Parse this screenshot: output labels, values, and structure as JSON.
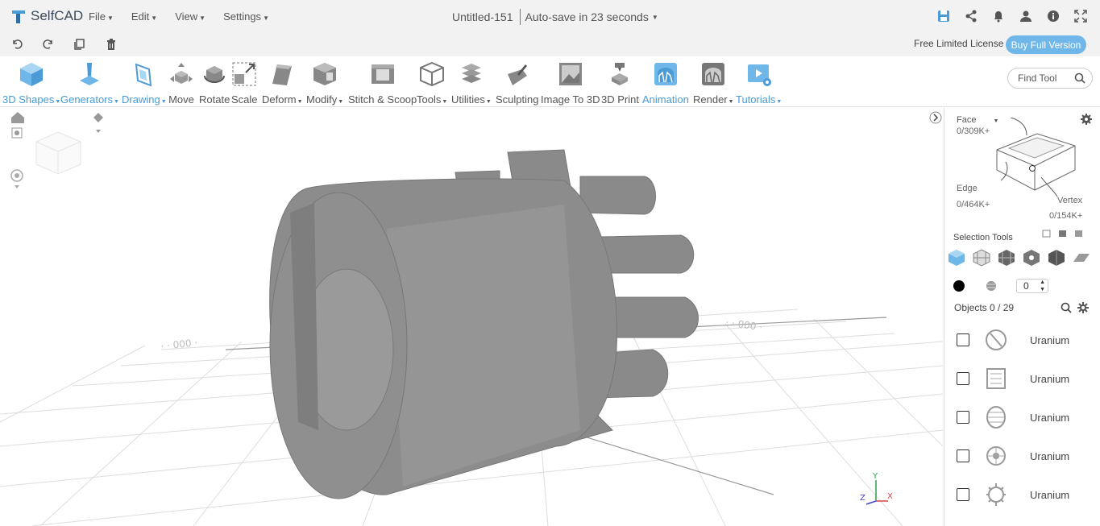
{
  "app": {
    "name": "SelfCAD",
    "brand_color": "#4a9bd6"
  },
  "menu": [
    {
      "label": "File"
    },
    {
      "label": "Edit"
    },
    {
      "label": "View"
    },
    {
      "label": "Settings"
    }
  ],
  "document": {
    "title": "Untitled-151",
    "autosave": "Auto-save in 23 seconds"
  },
  "top_icons": [
    "save-icon",
    "share-icon",
    "bell-icon",
    "user-icon",
    "info-icon",
    "fullscreen-icon"
  ],
  "secondary_icons": [
    "undo-icon",
    "redo-icon",
    "copy-icon",
    "delete-icon"
  ],
  "license": {
    "text": "Free Limited License",
    "button": "Buy Full Version"
  },
  "toolbar": {
    "tools": [
      {
        "label": "3D Shapes",
        "dropdown": true,
        "active": true
      },
      {
        "label": "Generators",
        "dropdown": true,
        "active": true
      },
      {
        "label": "Drawing",
        "dropdown": true,
        "active": true
      },
      {
        "label": "Move"
      },
      {
        "label": "Rotate"
      },
      {
        "label": "Scale"
      },
      {
        "label": "Deform",
        "dropdown": true
      },
      {
        "label": "Modify",
        "dropdown": true
      },
      {
        "label": "Stitch & Scoop"
      },
      {
        "label": "Tools",
        "dropdown": true
      },
      {
        "label": "Utilities",
        "dropdown": true
      },
      {
        "label": "Sculpting"
      },
      {
        "label": "Image To 3D"
      },
      {
        "label": "3D Print"
      },
      {
        "label": "Animation",
        "active": true
      },
      {
        "label": "Render",
        "dropdown": true
      },
      {
        "label": "Tutorials",
        "dropdown": true,
        "active": true
      }
    ],
    "find_placeholder": "Find Tool"
  },
  "panel": {
    "mode_label": "Face",
    "face_count": "0/309K+",
    "edge_label": "Edge",
    "edge_count": "0/464K+",
    "vertex_label": "Vertex",
    "vertex_count": "0/154K+",
    "selection_tools_label": "Selection Tools",
    "brush_size": "0",
    "objects_label": "Objects 0 / 29",
    "objects": [
      {
        "name": "Uranium"
      },
      {
        "name": "Uranium"
      },
      {
        "name": "Uranium"
      },
      {
        "name": "Uranium"
      },
      {
        "name": "Uranium"
      }
    ]
  },
  "axes": {
    "x": "X",
    "y": "Y",
    "z": "Z"
  }
}
